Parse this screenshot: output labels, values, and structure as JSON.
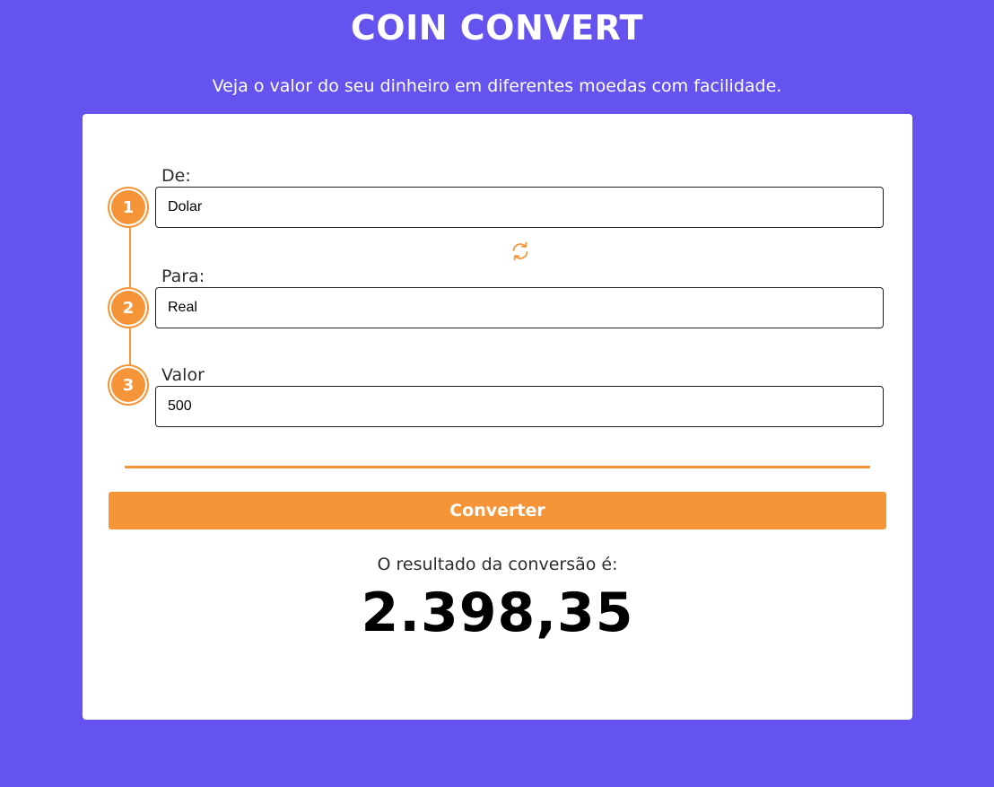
{
  "header": {
    "title": "COIN CONVERT",
    "subtitle": "Veja o valor do seu dinheiro em diferentes moedas com facilidade."
  },
  "form": {
    "steps": [
      "1",
      "2",
      "3"
    ],
    "from": {
      "label": "De:",
      "value": "Dolar"
    },
    "to": {
      "label": "Para:",
      "value": "Real"
    },
    "amount": {
      "label": "Valor",
      "value": "500"
    },
    "swap_icon": "swap-arrows-icon",
    "convert_label": "Converter"
  },
  "result": {
    "label": "O resultado da conversão é:",
    "value": "2.398,35"
  },
  "colors": {
    "background": "#6453ee",
    "accent": "#f59538",
    "card": "#ffffff"
  }
}
